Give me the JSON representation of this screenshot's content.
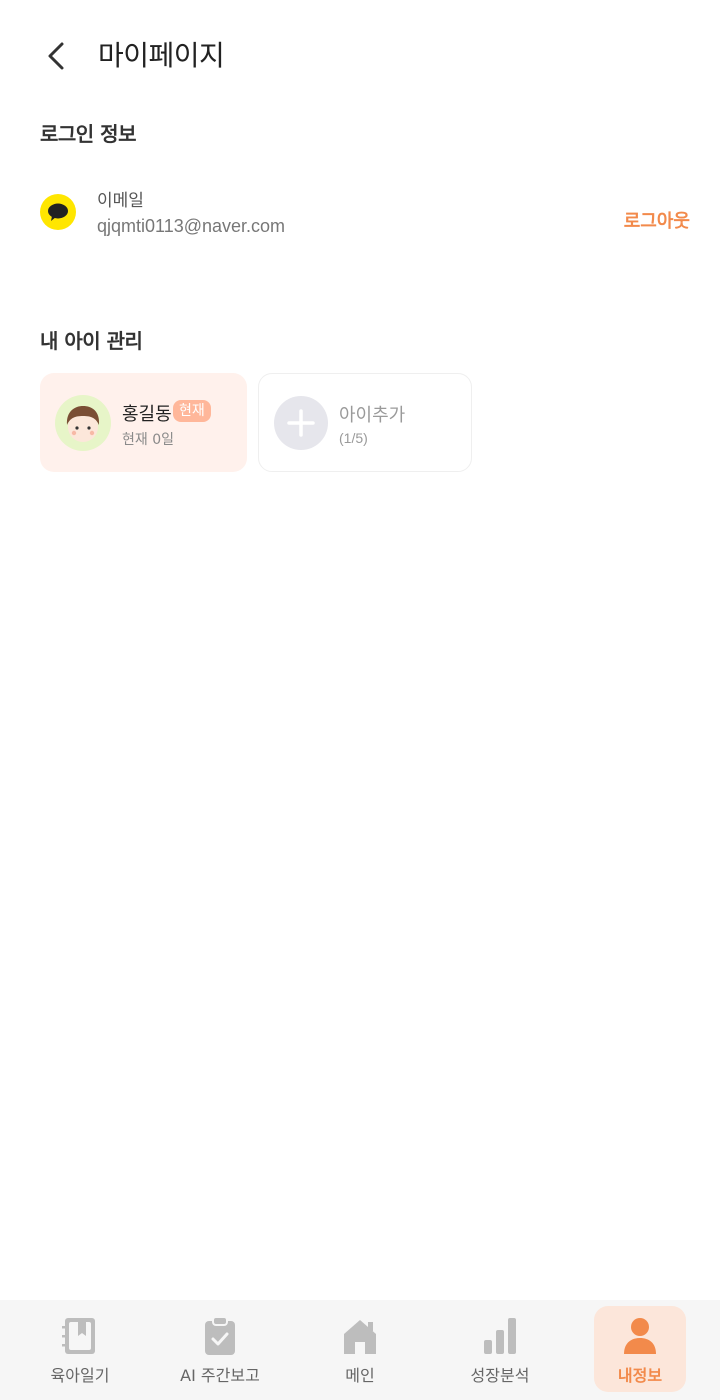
{
  "header": {
    "title": "마이페이지"
  },
  "login": {
    "section_title": "로그인 정보",
    "label": "이메일",
    "email": "qjqmti0113@naver.com",
    "logout": "로그아웃"
  },
  "kids": {
    "section_title": "내 아이 관리",
    "child": {
      "name": "홍길동",
      "badge": "현재",
      "age": "현재 0일"
    },
    "add": {
      "label": "아이추가",
      "count": "(1/5)"
    }
  },
  "tabbar": {
    "items": [
      {
        "label": "육아일기",
        "icon": "diary-icon"
      },
      {
        "label": "AI 주간보고",
        "icon": "clipboard-check-icon"
      },
      {
        "label": "메인",
        "icon": "home-icon"
      },
      {
        "label": "성장분석",
        "icon": "bar-chart-icon"
      },
      {
        "label": "내정보",
        "icon": "person-icon",
        "active": true
      }
    ]
  },
  "colors": {
    "accent": "#F28A4B",
    "kakao": "#FFE600",
    "card_bg": "#FFF1EC",
    "badge_bg": "#FFB79A"
  }
}
